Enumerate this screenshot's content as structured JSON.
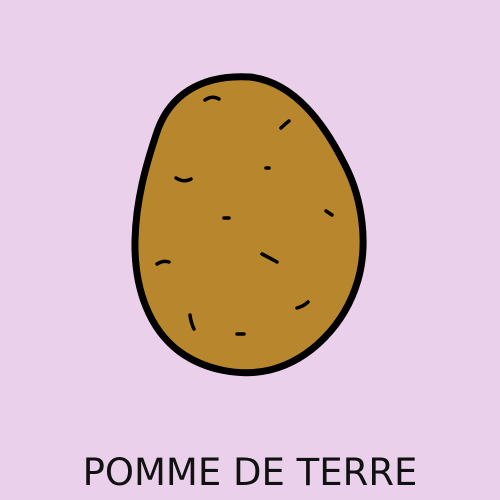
{
  "card": {
    "background_color": "#ebd0eb",
    "word": "POMME DE TERRE"
  },
  "illustration": {
    "subject": "potato-icon",
    "fill_color": "#b8862c",
    "outline_color": "#000000"
  }
}
